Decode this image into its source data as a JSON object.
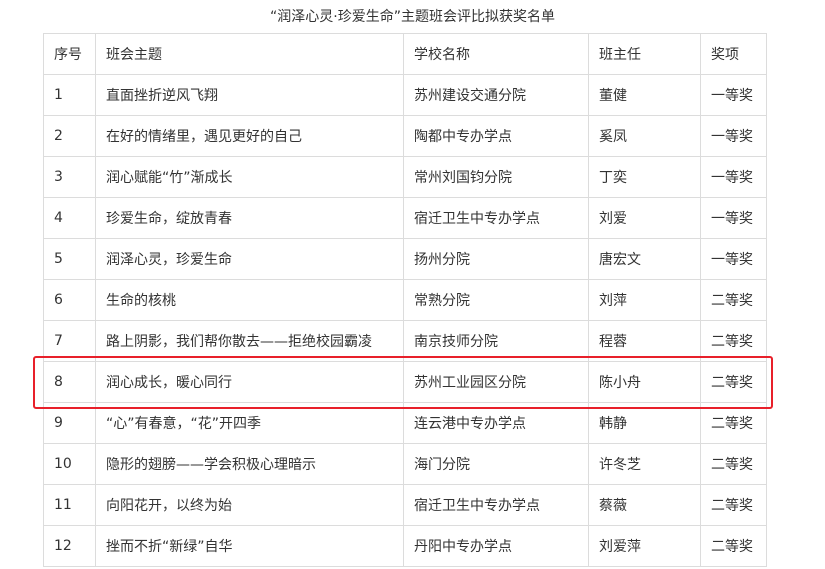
{
  "title": "“润泽心灵·珍爱生命”主题班会评比拟获奖名单",
  "columns": {
    "no": "序号",
    "topic": "班会主题",
    "school": "学校名称",
    "teacher": "班主任",
    "award": "奖项"
  },
  "rows": [
    {
      "no": "1",
      "topic": "直面挫折逆风飞翔",
      "school": "苏州建设交通分院",
      "teacher": "董健",
      "award": "一等奖"
    },
    {
      "no": "2",
      "topic": "在好的情绪里，遇见更好的自己",
      "school": "陶都中专办学点",
      "teacher": "奚凤",
      "award": "一等奖"
    },
    {
      "no": "3",
      "topic": "润心赋能“竹”渐成长",
      "school": "常州刘国钧分院",
      "teacher": "丁奕",
      "award": "一等奖"
    },
    {
      "no": "4",
      "topic": "珍爱生命，绽放青春",
      "school": "宿迁卫生中专办学点",
      "teacher": "刘爱",
      "award": "一等奖"
    },
    {
      "no": "5",
      "topic": "润泽心灵，珍爱生命",
      "school": "扬州分院",
      "teacher": "唐宏文",
      "award": "一等奖"
    },
    {
      "no": "6",
      "topic": "生命的核桃",
      "school": "常熟分院",
      "teacher": "刘萍",
      "award": "二等奖"
    },
    {
      "no": "7",
      "topic": "路上阴影，我们帮你散去——拒绝校园霸凌",
      "school": "南京技师分院",
      "teacher": "程蓉",
      "award": "二等奖"
    },
    {
      "no": "8",
      "topic": "润心成长，暖心同行",
      "school": "苏州工业园区分院",
      "teacher": "陈小舟",
      "award": "二等奖"
    },
    {
      "no": "9",
      "topic": "“心”有春意，“花”开四季",
      "school": "连云港中专办学点",
      "teacher": "韩静",
      "award": "二等奖"
    },
    {
      "no": "10",
      "topic": "隐形的翅膀——学会积极心理暗示",
      "school": "海门分院",
      "teacher": "许冬芝",
      "award": "二等奖"
    },
    {
      "no": "11",
      "topic": "向阳花开，以终为始",
      "school": "宿迁卫生中专办学点",
      "teacher": "蔡薇",
      "award": "二等奖"
    },
    {
      "no": "12",
      "topic": "挫而不折“新绿”自华",
      "school": "丹阳中专办学点",
      "teacher": "刘爱萍",
      "award": "二等奖"
    }
  ],
  "highlight_color": "#e8202a",
  "highlighted_row_no": "8"
}
